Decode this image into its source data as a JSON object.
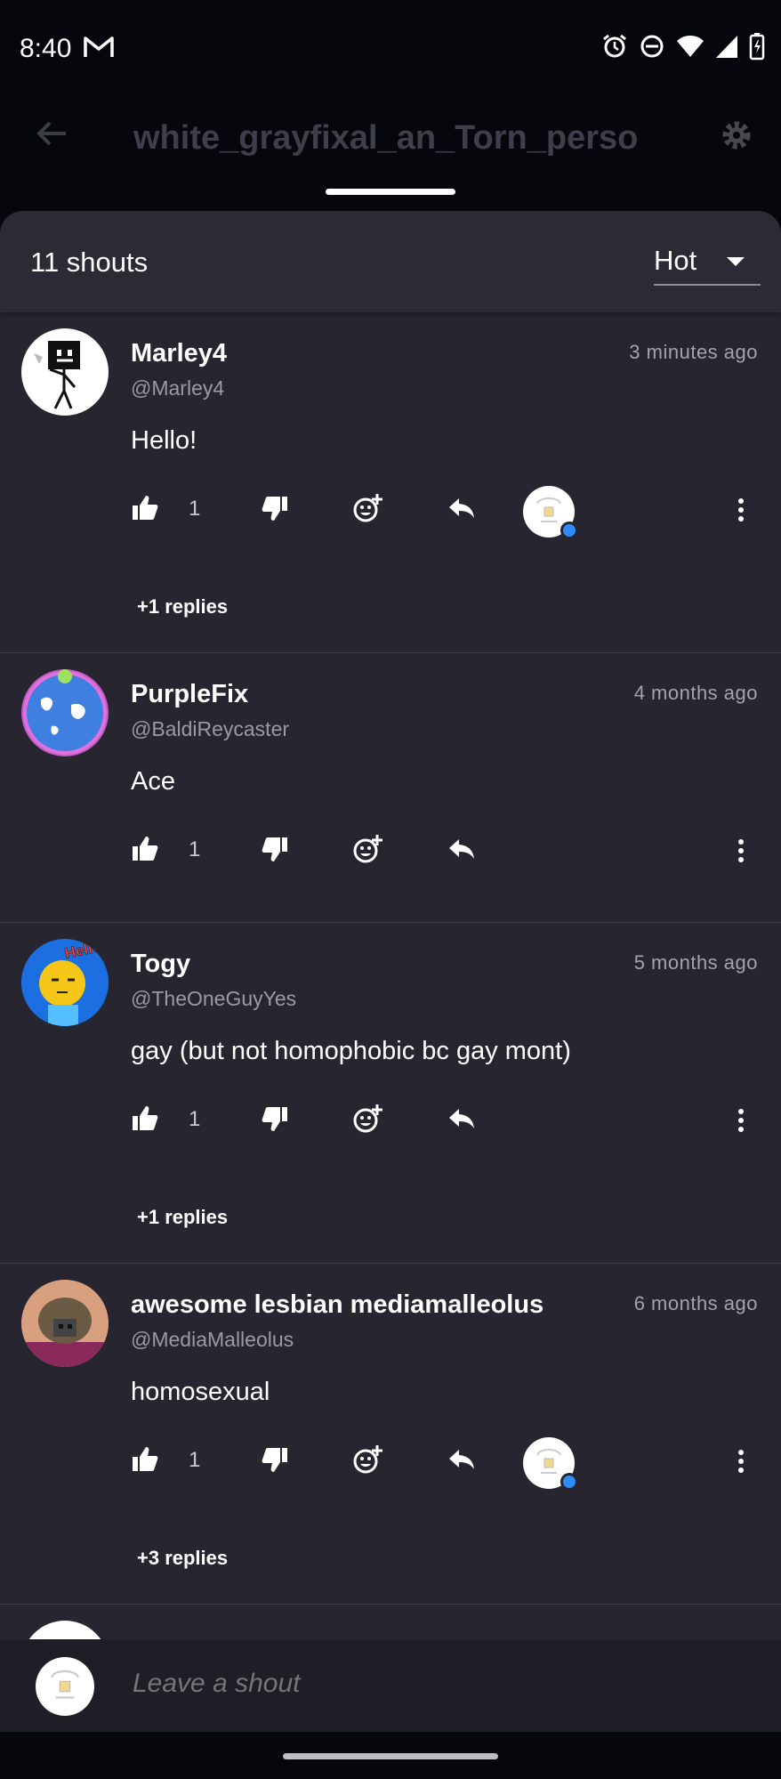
{
  "status_bar": {
    "time": "8:40",
    "icons": [
      "gmail-icon",
      "alarm-icon",
      "dnd-icon",
      "wifi-icon",
      "signal-icon",
      "battery-icon"
    ]
  },
  "header": {
    "title": "white_grayfixal_an_Torn_perso"
  },
  "sheet": {
    "count_label": "11 shouts",
    "sort_selected": "Hot"
  },
  "shouts": [
    {
      "name": "Marley4",
      "handle": "@Marley4",
      "time": "3 minutes ago",
      "text": "Hello!",
      "likes": "1",
      "replies": "+1 replies",
      "has_reply_avatar": true
    },
    {
      "name": "PurpleFix",
      "handle": "@BaldiReycaster",
      "time": "4 months ago",
      "text": "Ace",
      "likes": "1",
      "replies": "",
      "has_reply_avatar": false
    },
    {
      "name": "Togy",
      "handle": "@TheOneGuyYes",
      "time": "5 months ago",
      "text": "gay (but not homophobic bc gay mont)",
      "likes": "1",
      "replies": "+1 replies",
      "has_reply_avatar": false,
      "avatar_text": "Hello Bro"
    },
    {
      "name": "awesome lesbian mediamalleolus",
      "handle": "@MediaMalleolus",
      "time": "6 months ago",
      "text": "homosexual",
      "likes": "1",
      "replies": "+3 replies",
      "has_reply_avatar": true
    }
  ],
  "composer": {
    "placeholder": "Leave a shout"
  },
  "colors": {
    "background": "#06070d",
    "sheet": "#272630",
    "accent_online": "#2f8cff"
  }
}
